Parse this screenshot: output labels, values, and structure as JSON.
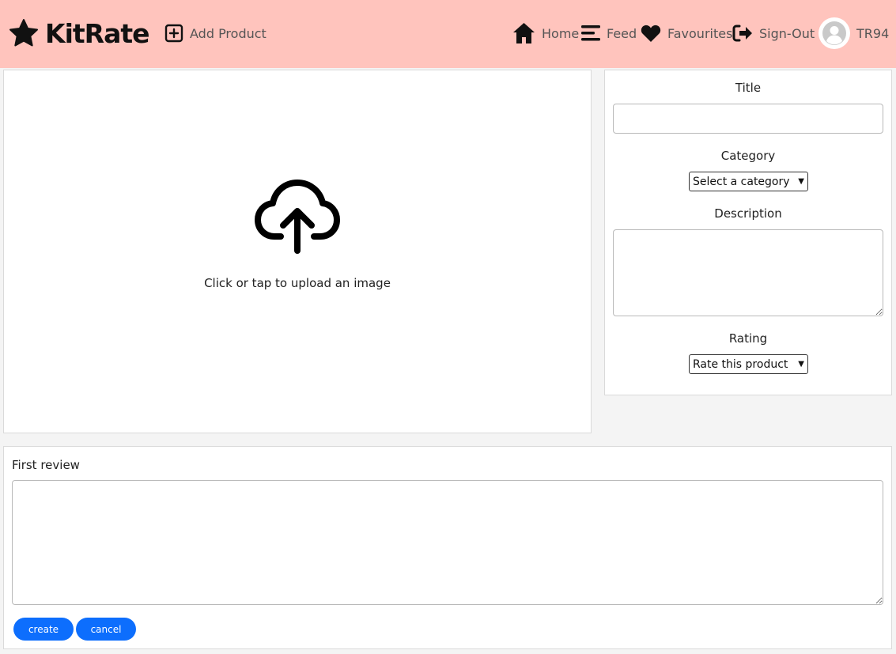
{
  "nav": {
    "brand": "KitRate",
    "add_product": "Add Product",
    "home": "Home",
    "feed": "Feed",
    "favourites": "Favourites",
    "sign_out": "Sign-Out",
    "username": "TR94"
  },
  "upload": {
    "text": "Click or tap to upload an image",
    "icon": "cloud-upload-icon"
  },
  "form": {
    "title_label": "Title",
    "title_value": "",
    "category_label": "Category",
    "category_selected": "Select a category",
    "description_label": "Description",
    "description_value": "",
    "rating_label": "Rating",
    "rating_selected": "Rate this product"
  },
  "review": {
    "label": "First review",
    "value": ""
  },
  "buttons": {
    "create": "create",
    "cancel": "cancel"
  },
  "colors": {
    "navbar": "#ffc4bd",
    "primary_button": "#0d6efd"
  }
}
